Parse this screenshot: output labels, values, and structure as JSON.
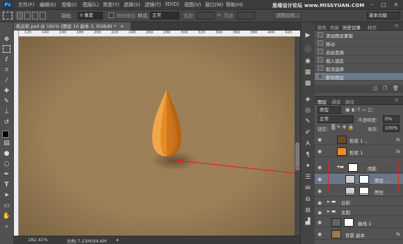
{
  "app": {
    "logo": "Ps",
    "menu": [
      "文件(F)",
      "编辑(E)",
      "图像(I)",
      "图层(L)",
      "类型(Y)",
      "选择(S)",
      "滤镜(T)",
      "3D(D)",
      "视图(V)",
      "窗口(W)",
      "帮助(H)"
    ],
    "watermark": "思缘设计论坛 www.MISSYUAN.COM",
    "window_controls": [
      "–",
      "□",
      "×"
    ]
  },
  "options": {
    "feather_label": "羽化:",
    "feather_value": "0 像素",
    "antialias_label": "消除锯齿",
    "style_label": "样式:",
    "style_value": "正常",
    "width_label": "宽度:",
    "height_label": "高度:",
    "refine_edge": "调整边缘...",
    "workspace": "基本功能"
  },
  "document": {
    "tab_title": "纸云彩.psd @ 182% (图层 10 副本 2, RGB/8) *",
    "tab_close": "×",
    "ruler_marks": [
      "120",
      "140",
      "160",
      "180",
      "200",
      "220",
      "240",
      "260",
      "280",
      "300",
      "320",
      "340",
      "360",
      "380",
      "400",
      "420"
    ],
    "zoom": "182.41%",
    "doc_size": "文档:7.23M/94.6M"
  },
  "colors": {
    "canvas": "#9c7b4f",
    "drop_light": "#f2a64a",
    "drop_mid": "#e58b24",
    "drop_dark": "#c96f16",
    "annotation": "#d42a2a"
  },
  "toolbox": {
    "tools": [
      "move-icon",
      "marquee-icon",
      "lasso-icon",
      "quick-select-icon",
      "crop-icon",
      "eyedropper-icon",
      "healing-icon",
      "brush-icon",
      "stamp-icon",
      "history-brush-icon",
      "eraser-icon",
      "gradient-icon",
      "blur-icon",
      "dodge-icon",
      "pen-icon",
      "type-icon",
      "path-select-icon",
      "shape-icon",
      "hand-icon",
      "zoom-icon"
    ]
  },
  "history": {
    "tabs": [
      "颜色",
      "色板",
      "历史记录",
      "样式"
    ],
    "items": [
      "添加图层蒙版",
      "移动",
      "自由变换",
      "载入选区",
      "取消选择",
      "删除图层"
    ]
  },
  "layers": {
    "tabs": [
      "图层",
      "通道",
      "路径"
    ],
    "kind": "类型",
    "blend_mode": "正常",
    "opacity_label": "不透明度:",
    "opacity": "0%",
    "lock_label": "锁定:",
    "fill_label": "填充:",
    "fill": "100%",
    "rows": [
      {
        "label": "形状 1 ...",
        "fx": "fx"
      },
      {
        "label": "形状 1",
        "fx": "fx"
      },
      {
        "label": "阴影",
        "fx": ""
      },
      {
        "label": "图层 ...",
        "fx": ""
      },
      {
        "label": "图层 ...",
        "fx": ""
      },
      {
        "label": "云彩",
        "fx": ""
      },
      {
        "label": "太阳",
        "fx": ""
      },
      {
        "label": "曲线 1",
        "fx": ""
      },
      {
        "label": "背景 副本",
        "fx": "fx"
      }
    ]
  }
}
